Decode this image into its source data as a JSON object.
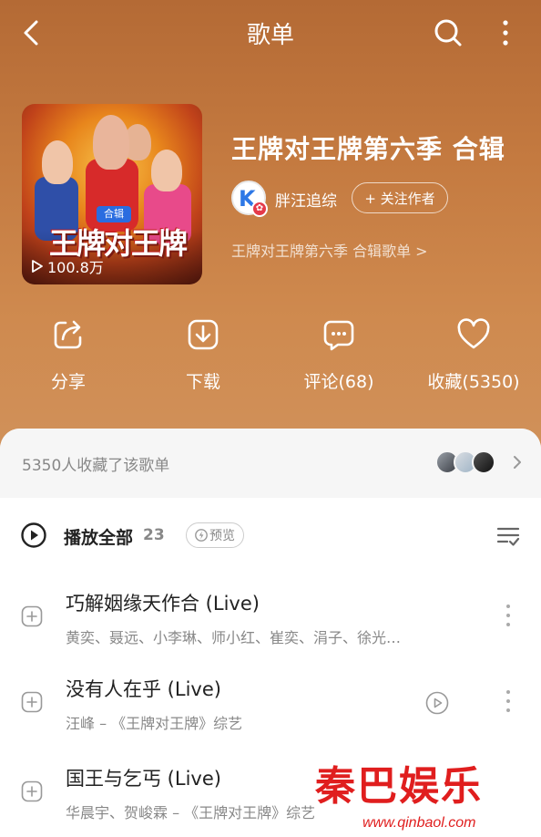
{
  "header": {
    "title": "歌单"
  },
  "playlist": {
    "title": "王牌对王牌第六季 合辑",
    "cover_tag": "合辑",
    "cover_logo": "王牌对王牌",
    "play_count": "100.8万",
    "author": "胖汪追综",
    "author_initial": "K",
    "follow_label": "+ 关注作者",
    "description": "王牌对王牌第六季 合辑歌单 >"
  },
  "actions": [
    {
      "label": "分享",
      "icon": "share-icon"
    },
    {
      "label": "下载",
      "icon": "download-icon"
    },
    {
      "label": "评论(68)",
      "icon": "comment-icon"
    },
    {
      "label": "收藏(5350)",
      "icon": "heart-icon"
    }
  ],
  "collectors": {
    "text": "5350人收藏了该歌单"
  },
  "play_all": {
    "label": "播放全部",
    "count": "23",
    "preview_label": "预览"
  },
  "songs": [
    {
      "name": "巧解姻缘天作合 (Live)",
      "artists": "黄奕、聂远、小李琳、师小红、崔奕、涓子、徐光…",
      "has_mv": false
    },
    {
      "name": "没有人在乎 (Live)",
      "artists": "汪峰 – 《王牌对王牌》综艺",
      "has_mv": true
    },
    {
      "name": "国王与乞丐 (Live)",
      "artists": "华晨宇、贺峻霖 – 《王牌对王牌》综艺",
      "has_mv": false
    }
  ],
  "watermark": {
    "text": "秦巴娱乐",
    "url": "www.qinbaol.com"
  },
  "colors": {
    "hero_top": "#b46a35",
    "hero_bottom": "#d0915a",
    "watermark_red": "#e01e1e",
    "follow_badge": "#e53a4a",
    "author_k": "#2e78e6"
  }
}
